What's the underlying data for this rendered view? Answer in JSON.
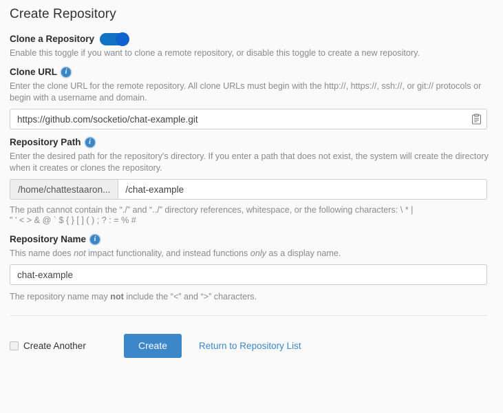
{
  "page": {
    "title": "Create Repository"
  },
  "clone_toggle": {
    "label": "Clone a Repository",
    "state": "on",
    "help": "Enable this toggle if you want to clone a remote repository, or disable this toggle to create a new repository."
  },
  "clone_url": {
    "label": "Clone URL",
    "info_glyph": "i",
    "help": "Enter the clone URL for the remote repository. All clone URLs must begin with the http://, https://, ssh://, or git:// protocols or begin with a username and domain.",
    "value": "https://github.com/socketio/chat-example.git",
    "placeholder": "",
    "paste_icon": "clipboard-paste-icon"
  },
  "repository_path": {
    "label": "Repository Path",
    "info_glyph": "i",
    "help": "Enter the desired path for the repository's directory. If you enter a path that does not exist, the system will create the directory when it creates or clones the repository.",
    "prefix": "/home/chattestaaron...",
    "value": "/chat-example",
    "placeholder": "",
    "note_line1": "The path cannot contain the “./” and “../” directory references, whitespace, or the following characters: \\ * |",
    "note_line2": "\" ' < > & @ ` $ { } [ ] ( ) ; ? : = % #"
  },
  "repository_name": {
    "label": "Repository Name",
    "info_glyph": "i",
    "help_prefix": "This name does ",
    "help_em1": "not",
    "help_mid": " impact functionality, and instead functions ",
    "help_em2": "only",
    "help_suffix": " as a display name.",
    "value": "chat-example",
    "placeholder": "",
    "note_prefix": "The repository name may ",
    "note_bold": "not",
    "note_suffix": " include the “<” and “>” characters."
  },
  "footer": {
    "create_another_label": "Create Another",
    "create_another_checked": false,
    "create_button": "Create",
    "return_link": "Return to Repository List"
  },
  "colors": {
    "accent_blue": "#3b87c9",
    "toggle_on": "#1272c4",
    "toggle_knob": "#0f62cf",
    "info_icon": "#3d86c6",
    "page_background": "#fafafa",
    "input_border": "#cccccc",
    "help_text": "#8a8a8a"
  }
}
